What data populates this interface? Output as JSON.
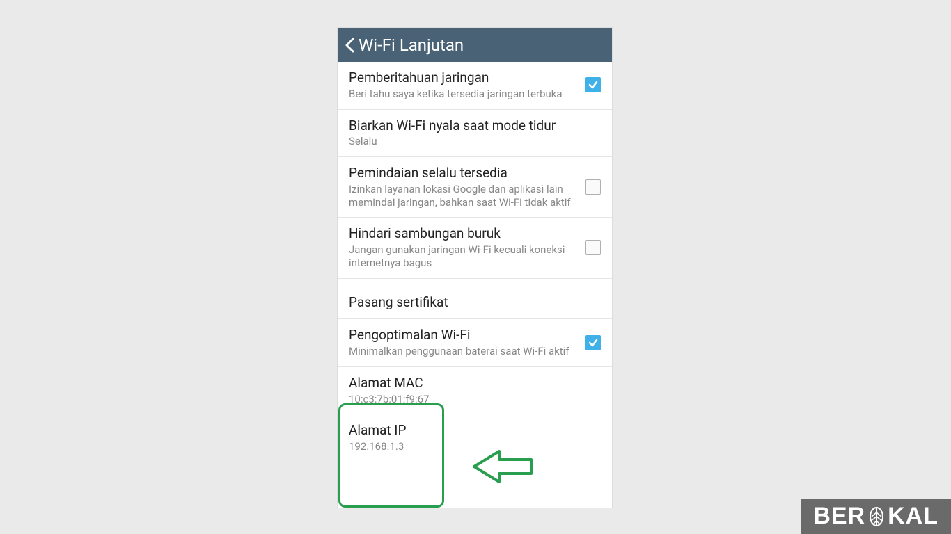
{
  "header": {
    "title": "Wi-Fi Lanjutan"
  },
  "items": {
    "network_notif": {
      "title": "Pemberitahuan jaringan",
      "sub": "Beri tahu saya ketika tersedia jaringan terbuka",
      "checked": true
    },
    "keep_wifi_sleep": {
      "title": "Biarkan Wi-Fi nyala saat mode tidur",
      "sub": "Selalu"
    },
    "scanning": {
      "title": "Pemindaian selalu tersedia",
      "sub": "Izinkan layanan lokasi Google dan aplikasi lain memindai jaringan, bahkan saat Wi-Fi tidak aktif",
      "checked": false
    },
    "avoid_poor": {
      "title": "Hindari sambungan buruk",
      "sub": "Jangan gunakan jaringan Wi-Fi kecuali koneksi internetnya bagus",
      "checked": false
    },
    "install_cert": {
      "title": "Pasang sertifikat"
    },
    "wifi_opt": {
      "title": "Pengoptimalan Wi-Fi",
      "sub": "Minimalkan penggunaan baterai saat Wi-Fi aktif",
      "checked": true
    },
    "mac_addr": {
      "title": "Alamat MAC",
      "sub": "10:c3:7b:01:f9:67"
    },
    "ip_addr": {
      "title": "Alamat IP",
      "sub": "192.168.1.3"
    }
  },
  "watermark": {
    "text_before": "BER",
    "text_after": "KAL"
  },
  "colors": {
    "header_bg": "#4a6275",
    "accent": "#3fb0e8",
    "highlight": "#2a9e4f"
  }
}
